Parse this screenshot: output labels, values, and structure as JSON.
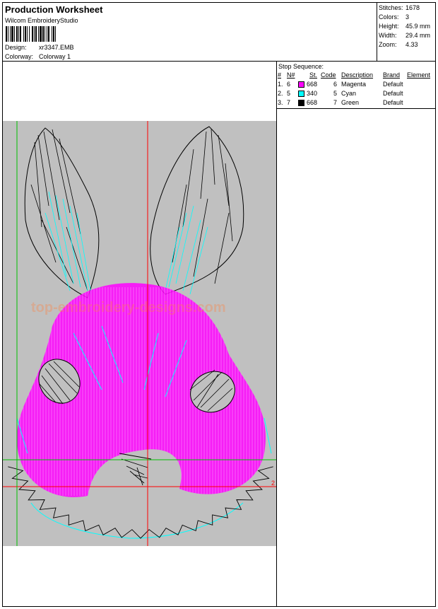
{
  "header": {
    "title": "Production Worksheet",
    "software": "Wilcom  EmbroideryStudio",
    "design_label": "Design:",
    "design_value": "xr3347.EMB",
    "colorway_label": "Colorway:",
    "colorway_value": "Colorway 1"
  },
  "stats": [
    {
      "label": "Stitches:",
      "value": "1678"
    },
    {
      "label": "Colors:",
      "value": "3"
    },
    {
      "label": "Height:",
      "value": "45.9 mm"
    },
    {
      "label": "Width:",
      "value": "29.4 mm"
    },
    {
      "label": "Zoom:",
      "value": "4.33"
    }
  ],
  "stop_sequence": {
    "title": "Stop Sequence:",
    "headers": {
      "num": "#",
      "n": "N#",
      "st": "St.",
      "code": "Code",
      "description": "Description",
      "brand": "Brand",
      "element": "Element"
    },
    "rows": [
      {
        "num": "1.",
        "n": "6",
        "color": "#ff00ff",
        "st": "668",
        "code": "6",
        "description": "Magenta",
        "brand": "Default"
      },
      {
        "num": "2.",
        "n": "5",
        "color": "#00ffff",
        "st": "340",
        "code": "5",
        "description": "Cyan",
        "brand": "Default"
      },
      {
        "num": "3.",
        "n": "7",
        "color": "#000000",
        "st": "668",
        "code": "7",
        "description": "Green",
        "brand": "Default"
      }
    ]
  },
  "preview": {
    "watermark": "top-embroidery-designs.com",
    "marker": "2",
    "background": "#c0c0c0",
    "guide_red": "#ff0000",
    "guide_green": "#00c000"
  }
}
